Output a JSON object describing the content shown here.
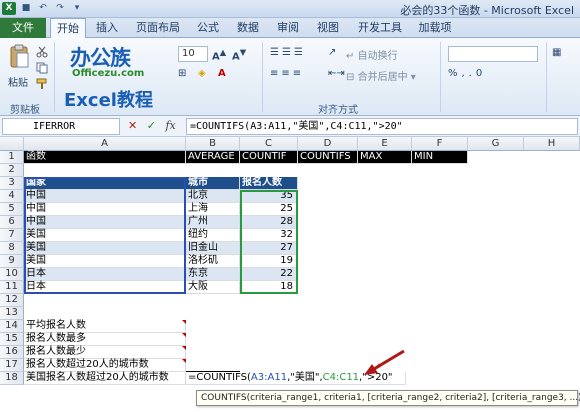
{
  "window": {
    "title": "必会的33个函数 - Microsoft Excel"
  },
  "ribbon": {
    "file_tab": "文件",
    "tabs": [
      "开始",
      "插入",
      "页面布局",
      "公式",
      "数据",
      "审阅",
      "视图",
      "开发工具",
      "加载项"
    ],
    "active_tab": 0,
    "paste_label": "粘贴",
    "clipboard_label": "剪贴板",
    "font_size": "10",
    "wrap_text_label": "自动换行",
    "merge_center_label": "合并后居中",
    "alignment_label": "对齐方式"
  },
  "watermark": {
    "brand_cn": "办公族",
    "brand_url": "Officezu.com",
    "brand_excel": "Excel教程"
  },
  "formula_bar": {
    "name_box": "IFERROR",
    "fx_label": "fx",
    "formula": "=COUNTIFS(A3:A11,\"美国\",C4:C11,\">20\""
  },
  "columns": [
    "A",
    "B",
    "C",
    "D",
    "E",
    "F",
    "G",
    "H"
  ],
  "rows": [
    "1",
    "2",
    "3",
    "4",
    "5",
    "6",
    "7",
    "8",
    "9",
    "10",
    "11",
    "12",
    "13",
    "14",
    "15",
    "16",
    "17",
    "18"
  ],
  "sheet": {
    "row1": {
      "a": "函数",
      "b": "AVERAGE",
      "c": "COUNTIF",
      "d": "COUNTIFS",
      "e": "MAX",
      "f": "MIN"
    },
    "table_headers": {
      "country": "国家",
      "city": "城市",
      "count": "报名人数"
    },
    "table_rows": [
      {
        "country": "中国",
        "city": "北京",
        "count": "35"
      },
      {
        "country": "中国",
        "city": "上海",
        "count": "25"
      },
      {
        "country": "中国",
        "city": "广州",
        "count": "28"
      },
      {
        "country": "美国",
        "city": "纽约",
        "count": "32"
      },
      {
        "country": "美国",
        "city": "旧金山",
        "count": "27"
      },
      {
        "country": "美国",
        "city": "洛杉矶",
        "count": "19"
      },
      {
        "country": "日本",
        "city": "东京",
        "count": "22"
      },
      {
        "country": "日本",
        "city": "大阪",
        "count": "18"
      }
    ],
    "questions": [
      "平均报名人数",
      "报名人数最多",
      "报名人数最少",
      "报名人数超过20人的城市数",
      "美国报名人数超过20人的城市数"
    ],
    "editing": {
      "fn": "=COUNTIFS(",
      "arg1": "A3:A11",
      "sep1": ",\"美国\",",
      "arg2": "C4:C11",
      "arg3": ",\">20\""
    }
  },
  "tooltip": {
    "text": "COUNTIFS(criteria_range1, criteria1, [criteria_range2, criteria2], [criteria_range3, ...)"
  },
  "colors": {
    "header_blue": "#1f4e8c",
    "band_blue": "#dce6f2",
    "arrow_red": "#b01818"
  }
}
